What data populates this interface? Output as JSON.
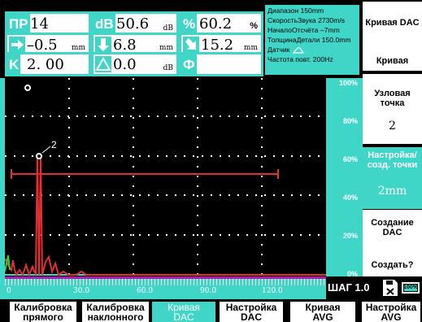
{
  "readouts": {
    "pr": {
      "label": "ПР",
      "value": "14"
    },
    "db": {
      "label": "dB",
      "value": "50.6",
      "unit": "dB"
    },
    "pct": {
      "label": "%",
      "value": "60.2",
      "unit": "%"
    },
    "arrow_right": {
      "value": "–0.5",
      "unit": "mm"
    },
    "arrow_down": {
      "value": "6.8",
      "unit": "mm"
    },
    "arrow_diag": {
      "value": "15.2",
      "unit": "mm"
    },
    "k": {
      "label": "K",
      "value": "2. 00"
    },
    "delta": {
      "value": "0.0",
      "unit": "dB"
    },
    "phi": {
      "label": "Ф",
      "value": ""
    }
  },
  "info": {
    "line1": "Диапазон 150mm",
    "line2": "СкоростьЗвука 2730m/s",
    "line3": "НачалоОтсчёта –7mm",
    "line4": "ТолщинаДетали 150.0mm",
    "line5": "Датчик",
    "line6": "Частота повт. 200Hz"
  },
  "vscale": [
    "100%",
    "80%",
    "60%",
    "40%",
    "20%",
    "0%"
  ],
  "hscale": [
    "0",
    "30.0",
    "60.0",
    "90.0",
    "120.0"
  ],
  "scan": {
    "point_label": "2",
    "point_amplitude_percent": 60.2
  },
  "step": "ШАГ 1.0",
  "battery": {
    "label": "100%",
    "level": 1.0
  },
  "right_menu": [
    {
      "title": "Кривая DAC",
      "value": "Кривая"
    },
    {
      "title": "Узловая точка",
      "value": "2"
    },
    {
      "title": "Настройка/созд. точки",
      "value": "2mm"
    },
    {
      "title": "Создание DAC",
      "value": "Создать?"
    }
  ],
  "bottom_menu": [
    {
      "line1": "Калибровка",
      "line2": "прямого"
    },
    {
      "line1": "Калибровка",
      "line2": "наклонного"
    },
    {
      "line1": "Кривая",
      "line2": "DAC"
    },
    {
      "line1": "Настройка",
      "line2": "DAC"
    },
    {
      "line1": "Кривая",
      "line2": "AVG"
    },
    {
      "line1": "Настройка",
      "line2": "AVG"
    }
  ],
  "colors": {
    "accent": "#3fd6c8",
    "signal": "#e23030",
    "grid": "#ffffff",
    "background": "#000000"
  }
}
